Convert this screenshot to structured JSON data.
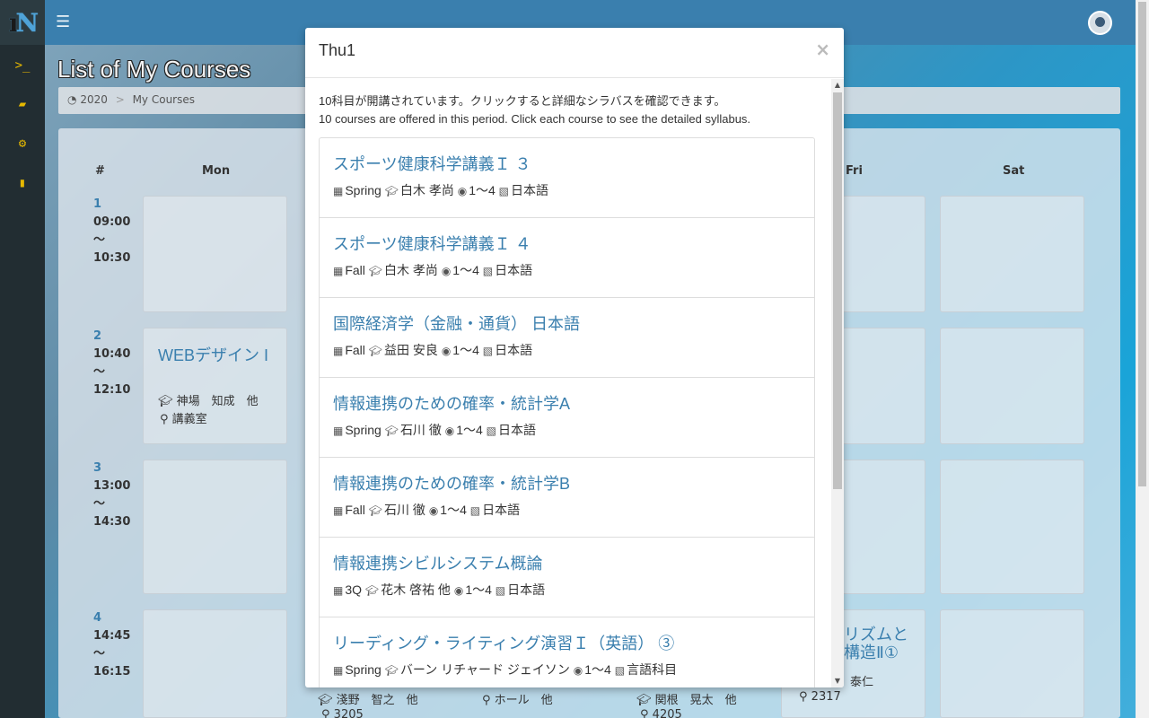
{
  "app": {
    "logo_text": "iN",
    "page_title": "List of My Courses"
  },
  "breadcrumb": [
    "2020",
    "My Courses"
  ],
  "timetable": {
    "header_num": "#",
    "days": [
      "Mon",
      "Fri",
      "Sat"
    ],
    "periods": [
      {
        "num": "1",
        "start": "09:00",
        "sep": "〜",
        "end": "10:30"
      },
      {
        "num": "2",
        "start": "10:40",
        "sep": "〜",
        "end": "12:10"
      },
      {
        "num": "3",
        "start": "13:00",
        "sep": "〜",
        "end": "14:30"
      },
      {
        "num": "4",
        "start": "14:45",
        "sep": "〜",
        "end": "16:15"
      }
    ],
    "mon_p2": {
      "title": "WEBデザイン I",
      "teacher": "神場　知成　他",
      "room": "講義室"
    },
    "fri_p4": {
      "title_1": "リズムと",
      "title_2": "構造Ⅱ①",
      "teacher": "泰仁",
      "room": "2317"
    },
    "row5": {
      "t1": "淺野　智之　他",
      "r1": "3205",
      "t2": "ホール　他",
      "t3": "関根　晃太　他",
      "r3": "4205"
    }
  },
  "modal": {
    "title": "Thu1",
    "close": "×",
    "intro_ja": "10科目が開講されています。クリックすると詳細なシラバスを確認できます。",
    "intro_en": "10 courses are offered in this period. Click each course to see the detailed syllabus.",
    "courses": [
      {
        "title": "スポーツ健康科学講義Ｉ ３",
        "term": "Spring",
        "teacher": "白木 孝尚",
        "grade": "1〜4",
        "lang": "日本語"
      },
      {
        "title": "スポーツ健康科学講義Ｉ ４",
        "term": "Fall",
        "teacher": "白木 孝尚",
        "grade": "1〜4",
        "lang": "日本語"
      },
      {
        "title": "国際経済学（金融・通貨） 日本語",
        "term": "Fall",
        "teacher": "益田 安良",
        "grade": "1〜4",
        "lang": "日本語"
      },
      {
        "title": "情報連携のための確率・統計学A",
        "term": "Spring",
        "teacher": "石川 徹",
        "grade": "1〜4",
        "lang": "日本語"
      },
      {
        "title": "情報連携のための確率・統計学B",
        "term": "Fall",
        "teacher": "石川 徹",
        "grade": "1〜4",
        "lang": "日本語"
      },
      {
        "title": "情報連携シビルシステム概論",
        "term": "3Q",
        "teacher": "花木 啓祐 他",
        "grade": "1〜4",
        "lang": "日本語"
      },
      {
        "title": "リーディング・ライティング演習Ｉ（英語） ③",
        "term": "Spring",
        "teacher": "バーン リチャード ジェイソン",
        "grade": "1〜4",
        "lang": "言語科目"
      }
    ]
  }
}
